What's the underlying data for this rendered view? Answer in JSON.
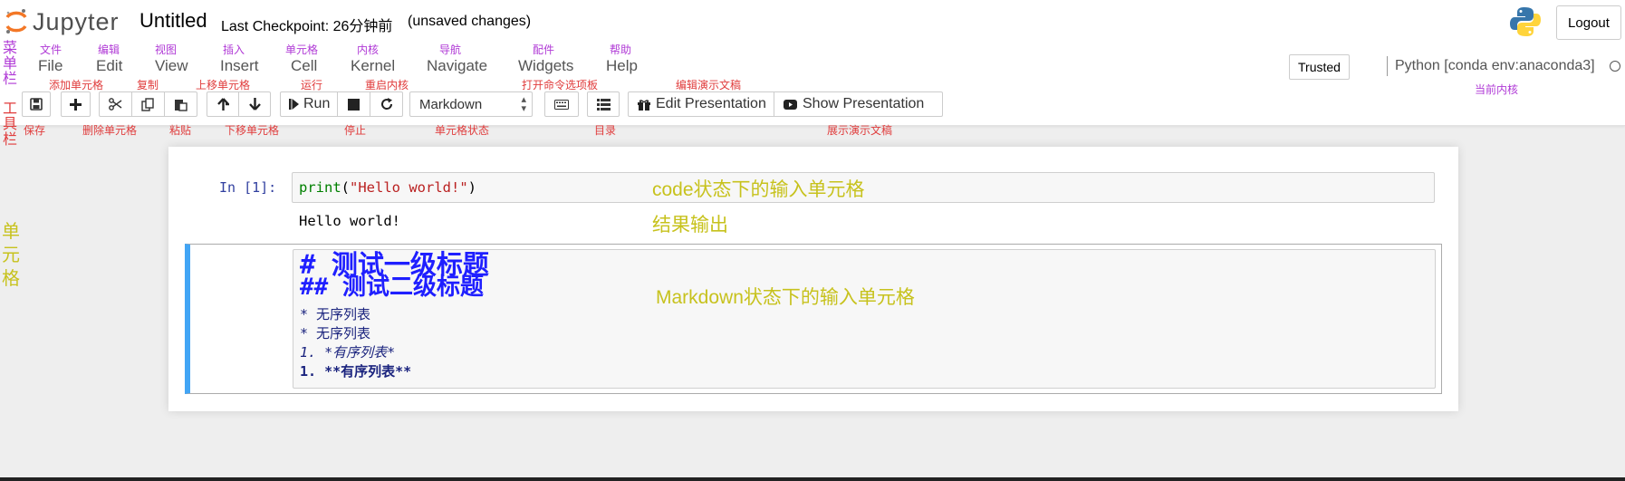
{
  "header": {
    "logo_text": "Jupyter",
    "notebook_title": "Untitled",
    "checkpoint": "Last Checkpoint: 26分钟前",
    "unsaved": "(unsaved changes)",
    "logout_label": "Logout"
  },
  "menu": {
    "items": [
      "File",
      "Edit",
      "View",
      "Insert",
      "Cell",
      "Kernel",
      "Navigate",
      "Widgets",
      "Help"
    ],
    "trusted_label": "Trusted",
    "kernel_name": "Python [conda env:anaconda3]"
  },
  "toolbar": {
    "run_label": "Run",
    "cell_type": "Markdown",
    "edit_presentation_label": "Edit Presentation",
    "show_presentation_label": "Show Presentation"
  },
  "annotations": {
    "menu_above": [
      "文件",
      "编辑",
      "视图",
      "插入",
      "单元格",
      "内核",
      "导航",
      "配件",
      "帮助"
    ],
    "toolbar_above": [
      "添加单元格",
      "复制",
      "上移单元格",
      "运行",
      "重启内核",
      "打开命令选项板",
      "编辑演示文稿"
    ],
    "toolbar_below": [
      "保存",
      "删除单元格",
      "粘贴",
      "下移单元格",
      "停止",
      "单元格状态",
      "目录",
      "展示演示文稿"
    ],
    "current_kernel": "当前内核",
    "menubar_label": [
      "菜",
      "单",
      "栏"
    ],
    "toolbar_label": [
      "工",
      "具",
      "栏"
    ],
    "cell_label": [
      "单",
      "元",
      "格"
    ],
    "code_input_note": "code状态下的输入单元格",
    "output_note": "结果输出",
    "markdown_input_note": "Markdown状态下的输入单元格"
  },
  "cells": {
    "code_prompt": "In [1]:",
    "code_func": "print",
    "code_open": "(",
    "code_string": "\"Hello world!\"",
    "code_close": ")",
    "output": "Hello world!",
    "markdown_lines": [
      "# 测试一级标题",
      "## 测试二级标题",
      "* 无序列表",
      "* 无序列表",
      "1. *有序列表*",
      "1. **有序列表**"
    ]
  },
  "colors": {
    "annotation_purple": "#b03ad6",
    "annotation_red": "#e03c3c",
    "annotation_yellow": "#c7c21d",
    "selected_cell_border": "#42a5f5"
  }
}
